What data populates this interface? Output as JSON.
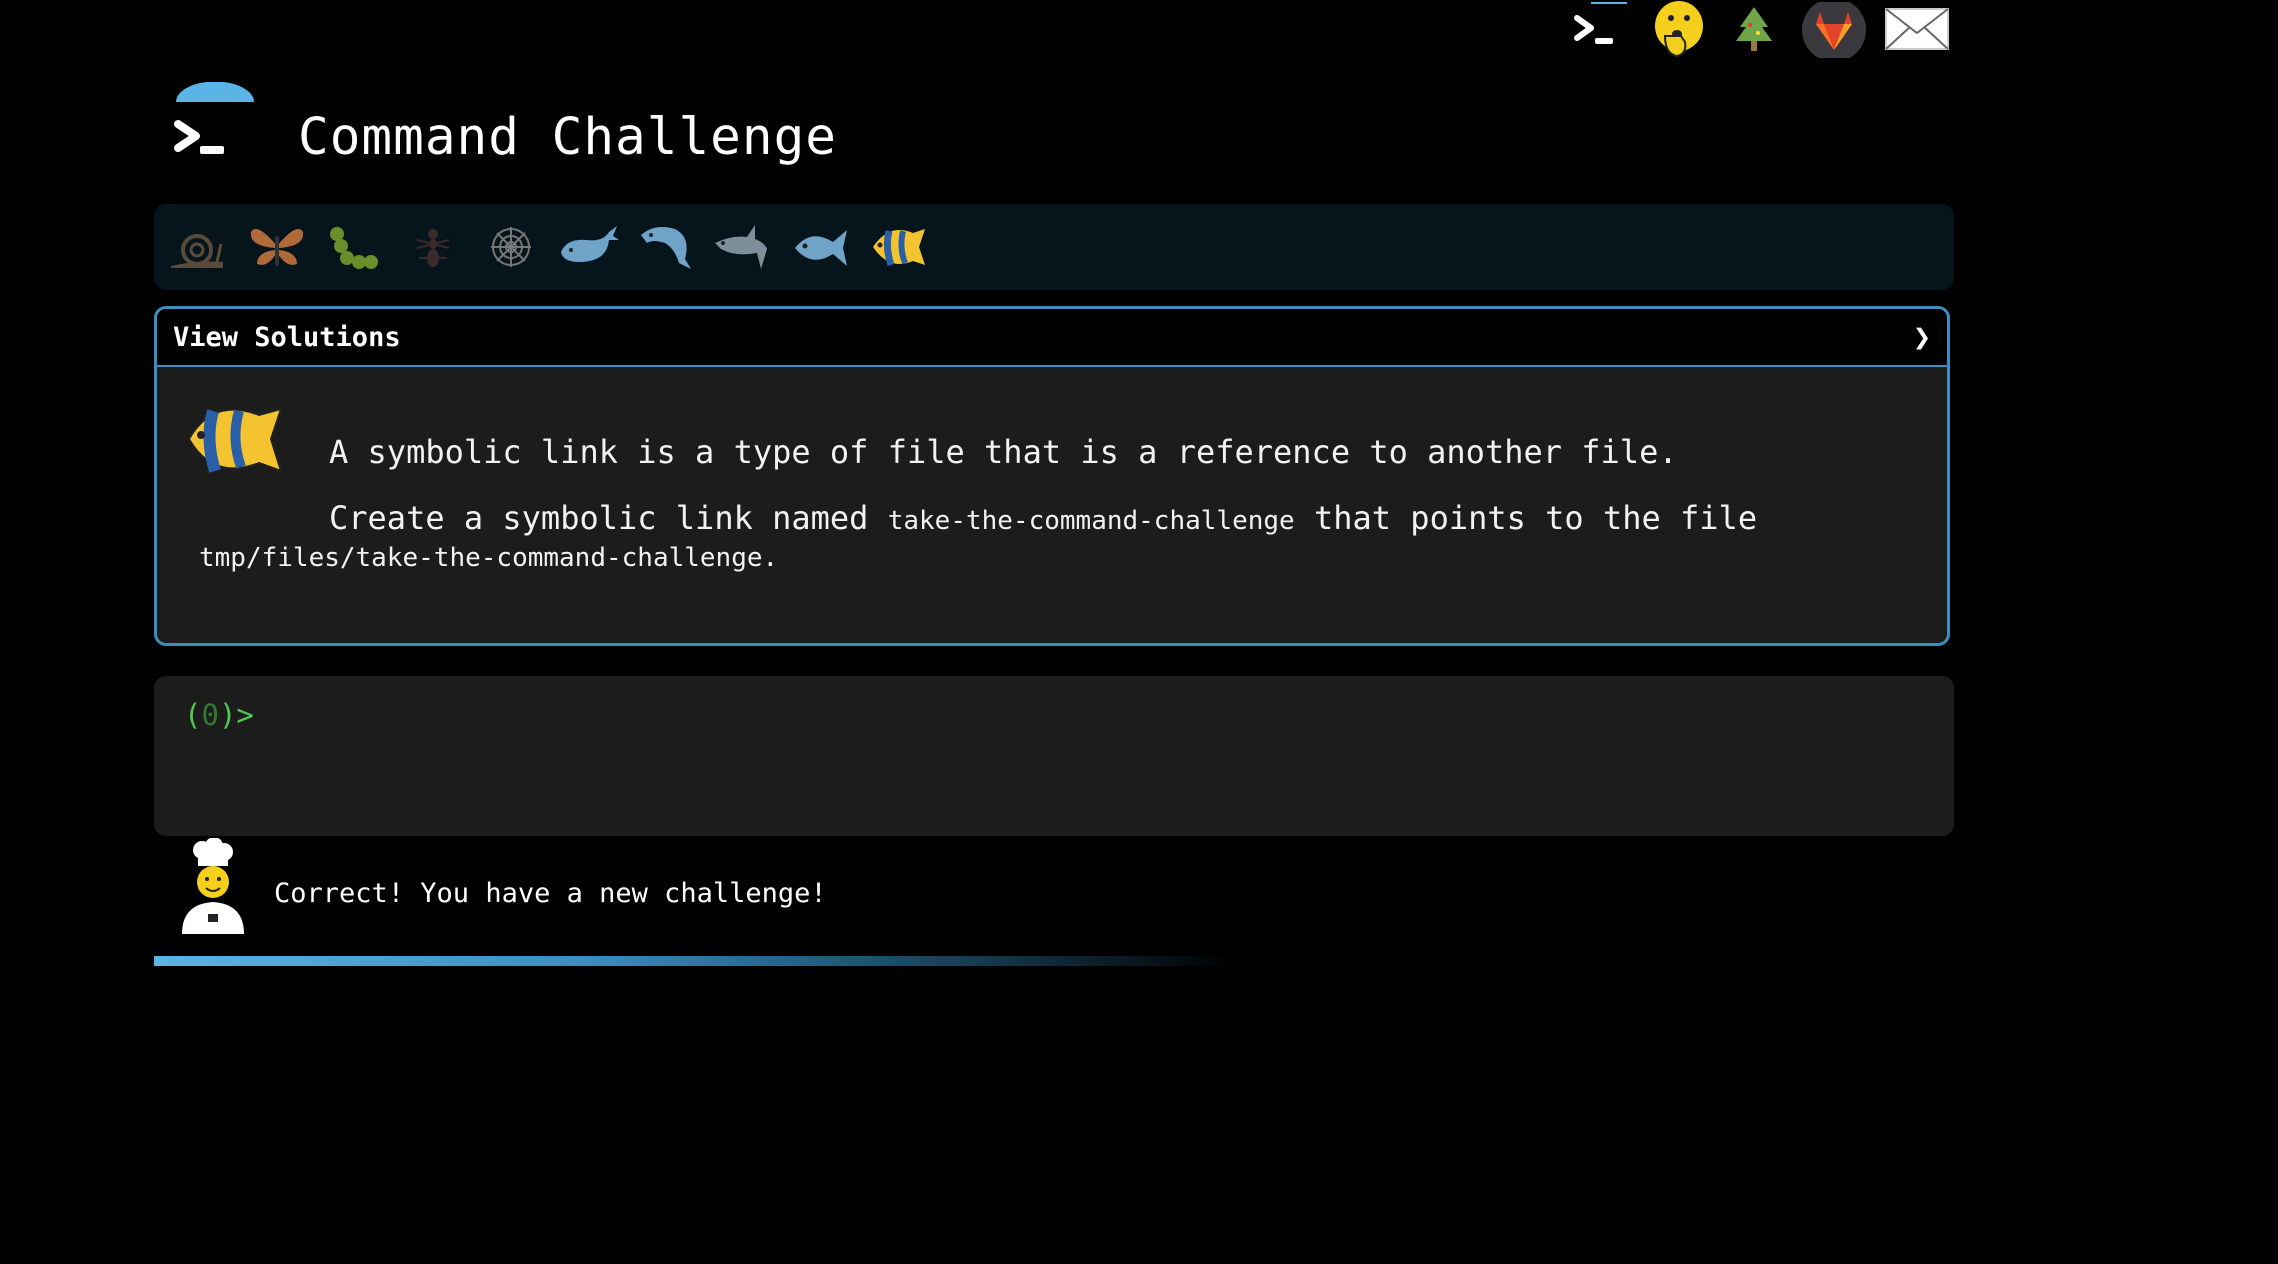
{
  "topnav": {
    "items": [
      {
        "name": "terminal",
        "icon": "terminal-icon"
      },
      {
        "name": "secret",
        "icon": "shushing-face-icon"
      },
      {
        "name": "tree",
        "icon": "tree-icon"
      },
      {
        "name": "gitlab",
        "icon": "gitlab-icon"
      },
      {
        "name": "mail",
        "icon": "envelope-icon"
      }
    ]
  },
  "header": {
    "title": "Command Challenge",
    "logo_icon": "terminal-prompt-icon"
  },
  "levels": [
    {
      "icon": "snail-icon"
    },
    {
      "icon": "butterfly-icon"
    },
    {
      "icon": "caterpillar-icon"
    },
    {
      "icon": "ant-icon"
    },
    {
      "icon": "spider-web-icon"
    },
    {
      "icon": "whale-icon"
    },
    {
      "icon": "dolphin-icon"
    },
    {
      "icon": "shark-icon"
    },
    {
      "icon": "fish-icon"
    },
    {
      "icon": "tropical-fish-icon"
    }
  ],
  "panel": {
    "header_label": "View Solutions",
    "chevron": "❯",
    "line1": "A symbolic link is a type of file that is a reference to another file.",
    "line2_pre": "Create a symbolic link named ",
    "line2_code": "take-the-command-challenge",
    "line2_post": " that points to the file",
    "line3_code": "tmp/files/take-the-command-challenge",
    "line3_post": "."
  },
  "terminal": {
    "prompt_open": "(",
    "prompt_num": "0",
    "prompt_close": ")>"
  },
  "feedback": {
    "message": "Correct! You have a new challenge!"
  },
  "progress": {
    "level": 0.48
  },
  "colors": {
    "accent": "#3a8fbf",
    "prompt_green": "#4ec94e",
    "panel_bg": "#1c1c1c"
  }
}
